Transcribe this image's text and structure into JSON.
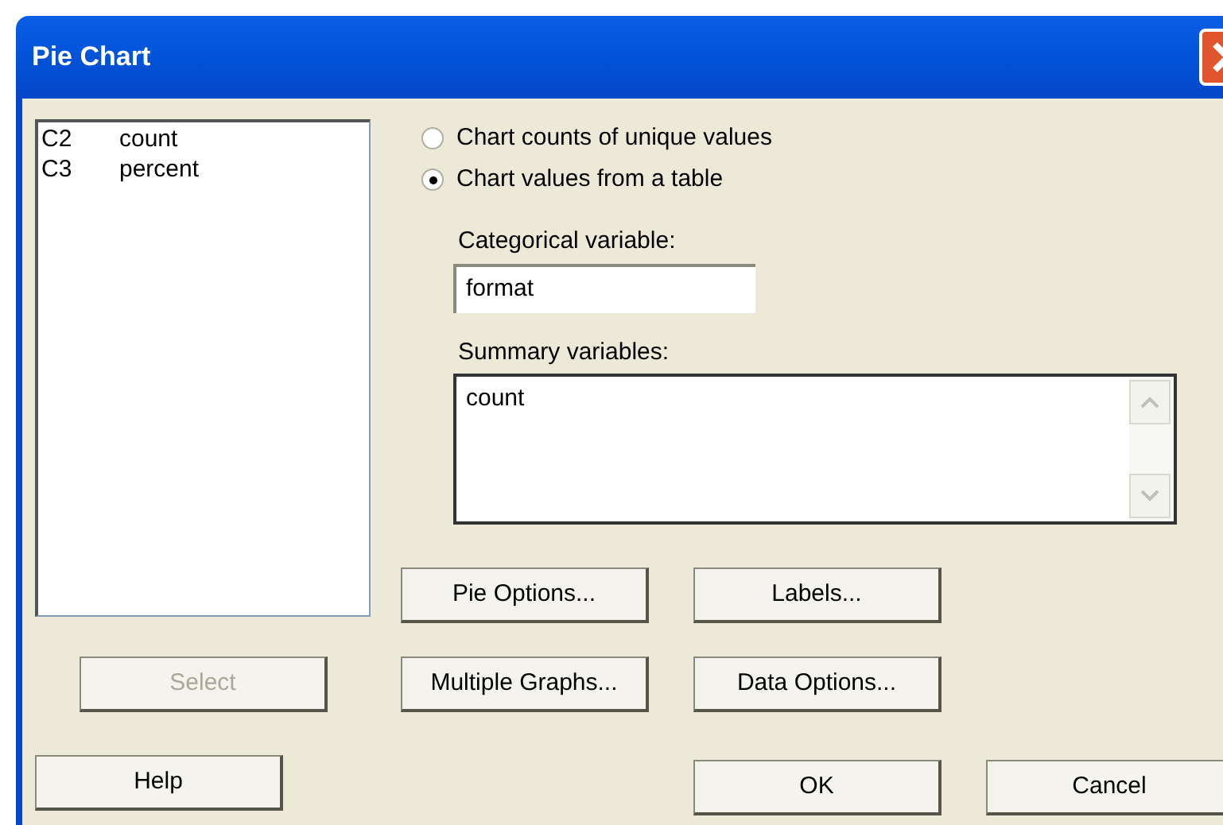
{
  "window": {
    "title": "Pie Chart"
  },
  "variables": [
    {
      "column": "C2",
      "name": "count"
    },
    {
      "column": "C3",
      "name": "percent"
    }
  ],
  "chart_modes": [
    {
      "label": "Chart counts of unique values",
      "selected": false
    },
    {
      "label": "Chart values from a table",
      "selected": true
    }
  ],
  "categorical_variable": {
    "label": "Categorical variable:",
    "value": "format"
  },
  "summary_variables": {
    "label": "Summary variables:",
    "value": "count"
  },
  "select_button": {
    "label": "Select",
    "disabled": true
  },
  "help_button": {
    "label": "Help"
  },
  "option_buttons": [
    {
      "label": "Pie Options..."
    },
    {
      "label": "Labels..."
    },
    {
      "label": "Multiple Graphs..."
    },
    {
      "label": "Data Options..."
    }
  ],
  "ok_button": {
    "label": "OK"
  },
  "cancel_button": {
    "label": "Cancel"
  }
}
